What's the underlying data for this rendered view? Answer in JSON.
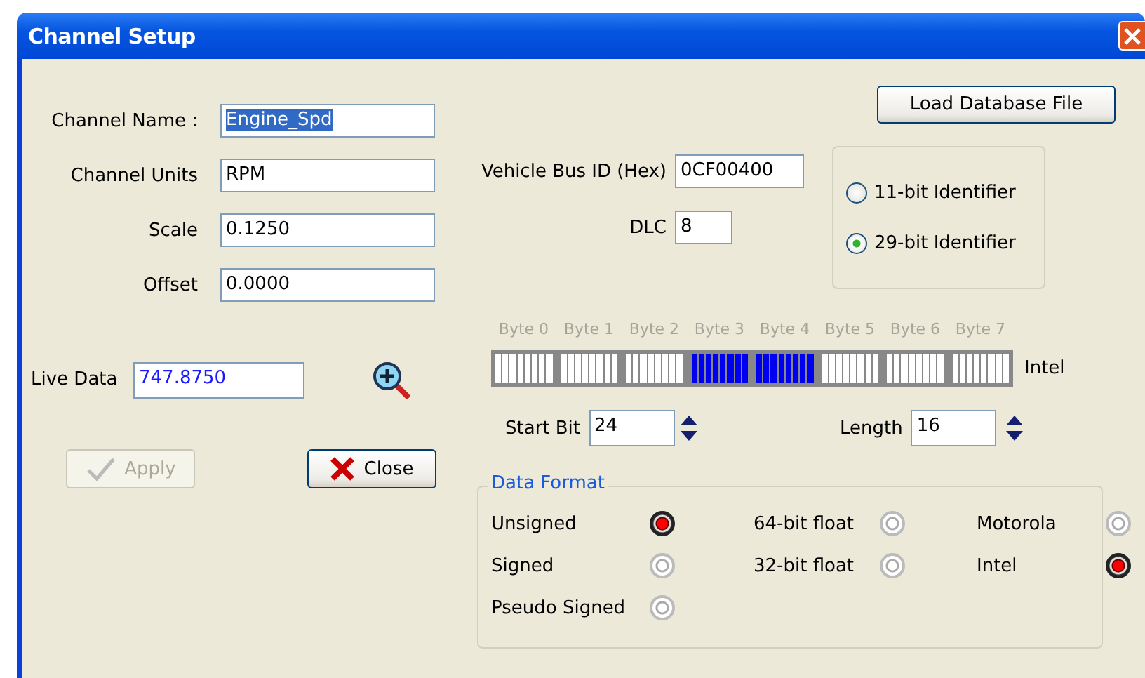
{
  "window": {
    "title": "Channel Setup"
  },
  "channel_fields": [
    {
      "label": "Channel Name :",
      "value": "Engine_Spd",
      "selected": true
    },
    {
      "label": "Channel Units",
      "value": "RPM",
      "selected": false
    },
    {
      "label": "Scale",
      "value": "0.1250",
      "selected": false
    },
    {
      "label": "Offset",
      "value": "0.0000",
      "selected": false
    }
  ],
  "live_data": {
    "label": "Live Data",
    "value": "747.8750"
  },
  "buttons": [
    {
      "label": "Apply",
      "kind": "apply",
      "disabled": true
    },
    {
      "label": "Close",
      "kind": "close",
      "disabled": false
    }
  ],
  "load_button": "Load Database File",
  "bus_fields": [
    {
      "label": "Vehicle Bus ID (Hex)",
      "value": "0CF00400"
    },
    {
      "label": "DLC",
      "value": "8"
    }
  ],
  "identifier_options": [
    {
      "label": "11-bit Identifier",
      "selected": false
    },
    {
      "label": "29-bit Identifier",
      "selected": true
    }
  ],
  "byte_map": {
    "byte_order": "Intel",
    "bytes": [
      {
        "label": "Byte 0",
        "selected": false
      },
      {
        "label": "Byte 1",
        "selected": false
      },
      {
        "label": "Byte 2",
        "selected": false
      },
      {
        "label": "Byte 3",
        "selected": true
      },
      {
        "label": "Byte 4",
        "selected": true
      },
      {
        "label": "Byte 5",
        "selected": false
      },
      {
        "label": "Byte 6",
        "selected": false
      },
      {
        "label": "Byte 7",
        "selected": false
      }
    ]
  },
  "start_bit": {
    "label": "Start Bit",
    "value": "24"
  },
  "length": {
    "label": "Length",
    "value": "16"
  },
  "data_format": {
    "title": "Data Format",
    "columns": [
      [
        {
          "label": "Unsigned",
          "selected": true
        },
        {
          "label": "Signed",
          "selected": false
        },
        {
          "label": "Pseudo Signed",
          "selected": false
        }
      ],
      [
        {
          "label": "64-bit float",
          "selected": false
        },
        {
          "label": "32-bit float",
          "selected": false
        }
      ],
      [
        {
          "label": "Motorola",
          "selected": false
        },
        {
          "label": "Intel",
          "selected": true
        }
      ]
    ]
  }
}
